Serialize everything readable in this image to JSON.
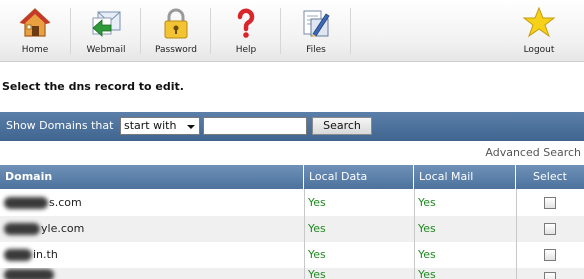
{
  "toolbar": {
    "items": [
      {
        "label": "Home",
        "icon": "home-icon"
      },
      {
        "label": "Webmail",
        "icon": "webmail-icon"
      },
      {
        "label": "Password",
        "icon": "padlock-icon"
      },
      {
        "label": "Help",
        "icon": "help-question-icon"
      },
      {
        "label": "Files",
        "icon": "files-icon"
      },
      {
        "label": "Logout",
        "icon": "star-logout-icon"
      }
    ]
  },
  "page": {
    "title": "Select the dns record to edit."
  },
  "search": {
    "label": "Show Domains that",
    "filter_selected": "start with",
    "query_value": "",
    "button_label": "Search",
    "advanced_link": "Advanced Search"
  },
  "table": {
    "headers": {
      "domain": "Domain",
      "local_data": "Local Data",
      "local_mail": "Local Mail",
      "select": "Select"
    },
    "rows": [
      {
        "domain_visible": "s.com",
        "local_data": "Yes",
        "local_mail": "Yes",
        "selected": false
      },
      {
        "domain_visible": "yle.com",
        "local_data": "Yes",
        "local_mail": "Yes",
        "selected": false
      },
      {
        "domain_visible": "in.th",
        "local_data": "Yes",
        "local_mail": "Yes",
        "selected": false
      },
      {
        "domain_visible": "",
        "local_data": "Yes",
        "local_mail": "Yes",
        "selected": false
      }
    ]
  },
  "colors": {
    "header_blue": "#4c729d",
    "yes_green": "#1f8a1f"
  }
}
